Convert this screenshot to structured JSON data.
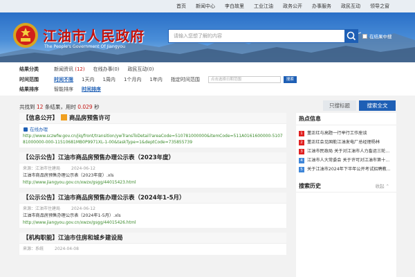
{
  "nav": [
    "首页",
    "新闻中心",
    "李白故里",
    "工业江油",
    "政务公开",
    "办事服务",
    "政民互动",
    "领导之窗"
  ],
  "header": {
    "title": "江油市人民政府",
    "subtitle": "The People's Government Of Jiangyou",
    "search_placeholder": "请输入您想了解的内容",
    "search_within": "在结果中搜"
  },
  "filters": {
    "type_label": "结果分类",
    "type_options": [
      {
        "label": "新闻资讯",
        "count": "(12)",
        "active": false
      },
      {
        "label": "在线办事",
        "count": "(0)",
        "active": false
      },
      {
        "label": "政民互动",
        "count": "(0)",
        "active": false
      }
    ],
    "time_label": "时间范围",
    "time_options": [
      "时间不限",
      "1天内",
      "1周内",
      "1个月内",
      "1年内"
    ],
    "time_custom": "指定时间范围",
    "date_placeholder": "点击选择日期范围",
    "search_btn": "搜索",
    "sort_label": "结果排序",
    "sort_options": [
      "智能排序",
      "时间排序"
    ]
  },
  "stats": {
    "prefix": "共找到",
    "count": "12",
    "mid": "条结果，用时",
    "time": "0.029",
    "suffix": "秒"
  },
  "buttons": {
    "title_search": "只搜标题",
    "full_search": "搜索全文"
  },
  "results": [
    {
      "title_tag": "【信息公开】",
      "title_text": "商品房预售许可",
      "tag": "在线办理",
      "url": "http://www.sczwfw.gov.cn/jiq/front/transition/ywTransToDetail?areaCode=510781000000&itemCode=511A0161600000-510781000000-000-11510681MB0P9971XL-1-00&taskType=1&deptCode=735855739"
    },
    {
      "title_tag": "【公示公告】",
      "title_text": "江油市商品房预售办理公示表（2023年度）",
      "source": "来源：江油市住建局",
      "date": "2024-06-12",
      "summary": "江油市商品房预售办理公示表（2023年度）.xls",
      "url": "http://www.jiangyou.gov.cn/xwzx/gsgg/44015423.html"
    },
    {
      "title_tag": "【公示公告】",
      "title_text": "江油市商品房预售办理公示表（2024年1-5月）",
      "source": "来源：江油市住建局",
      "date": "2024-06-12",
      "summary": "江油市商品房预售办理公示表（2024年1-5月）.xls",
      "url": "http://www.jiangyou.gov.cn/xwzx/gsgg/44015426.html"
    },
    {
      "title_tag": "【机构职能】",
      "title_text": "江油市住房和城乡建设局",
      "source": "来源：系统",
      "date": "2024-04-08"
    }
  ],
  "sidebar": {
    "hot_title": "热点信息",
    "hot_items": [
      "董正红与高题一行举行工作座谈",
      "董正红会见国能江油发电厂总经理杨林",
      "江油市民政局 关于对江油市人力畜运三轮...",
      "江油市人大常委会 关于许可对江油市第十...",
      "关于江油市2024年下半年公开考试招聘教..."
    ],
    "history_title": "搜索历史",
    "collapse": "收起"
  },
  "colors": {
    "brand_blue": "#1e5fb5",
    "brand_red": "#c4120e",
    "link_green": "#3a8a2a"
  }
}
